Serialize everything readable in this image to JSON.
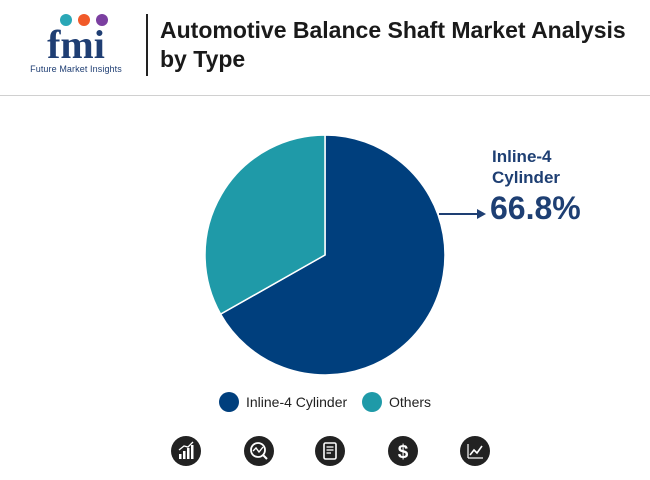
{
  "header": {
    "logo_text": "Future Market Insights",
    "title": "Automotive Balance Shaft Market Analysis by Type"
  },
  "colors": {
    "inline4": "#003f7d",
    "others": "#1f9aa8",
    "accent": "#1e3f73"
  },
  "callout": {
    "label_line1": "Inline-4",
    "label_line2": "Cylinder",
    "value": "66.8%"
  },
  "chart_data": {
    "type": "pie",
    "title": "Automotive Balance Shaft Market Analysis by Type",
    "slices": [
      {
        "name": "Inline-4 Cylinder",
        "value": 66.8
      },
      {
        "name": "Others",
        "value": 33.2
      }
    ],
    "legend_placement": "bottom"
  },
  "legend": {
    "items": [
      "Inline-4 Cylinder",
      "Others"
    ]
  },
  "footer_icons": [
    "bar-chart-icon",
    "analysis-icon",
    "document-icon",
    "dollar-icon",
    "trend-chart-icon"
  ]
}
